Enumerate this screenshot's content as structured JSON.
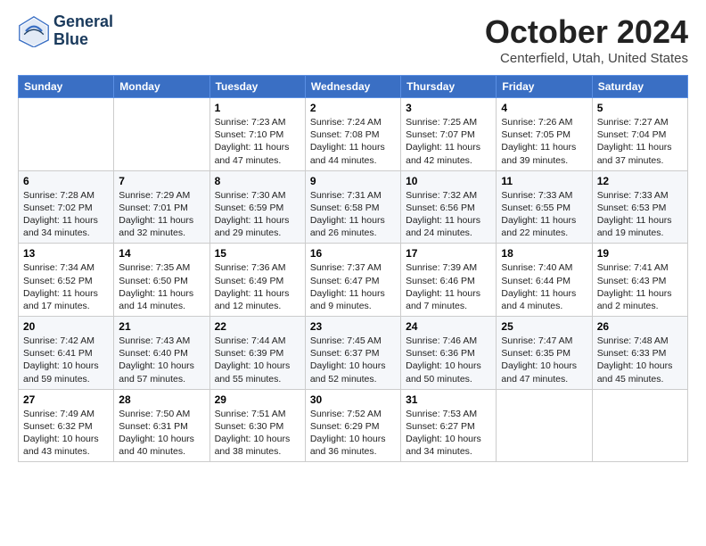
{
  "logo": {
    "line1": "General",
    "line2": "Blue"
  },
  "title": "October 2024",
  "subtitle": "Centerfield, Utah, United States",
  "days_of_week": [
    "Sunday",
    "Monday",
    "Tuesday",
    "Wednesday",
    "Thursday",
    "Friday",
    "Saturday"
  ],
  "weeks": [
    [
      {
        "day": "",
        "info": ""
      },
      {
        "day": "",
        "info": ""
      },
      {
        "day": "1",
        "info": "Sunrise: 7:23 AM\nSunset: 7:10 PM\nDaylight: 11 hours and 47 minutes."
      },
      {
        "day": "2",
        "info": "Sunrise: 7:24 AM\nSunset: 7:08 PM\nDaylight: 11 hours and 44 minutes."
      },
      {
        "day": "3",
        "info": "Sunrise: 7:25 AM\nSunset: 7:07 PM\nDaylight: 11 hours and 42 minutes."
      },
      {
        "day": "4",
        "info": "Sunrise: 7:26 AM\nSunset: 7:05 PM\nDaylight: 11 hours and 39 minutes."
      },
      {
        "day": "5",
        "info": "Sunrise: 7:27 AM\nSunset: 7:04 PM\nDaylight: 11 hours and 37 minutes."
      }
    ],
    [
      {
        "day": "6",
        "info": "Sunrise: 7:28 AM\nSunset: 7:02 PM\nDaylight: 11 hours and 34 minutes."
      },
      {
        "day": "7",
        "info": "Sunrise: 7:29 AM\nSunset: 7:01 PM\nDaylight: 11 hours and 32 minutes."
      },
      {
        "day": "8",
        "info": "Sunrise: 7:30 AM\nSunset: 6:59 PM\nDaylight: 11 hours and 29 minutes."
      },
      {
        "day": "9",
        "info": "Sunrise: 7:31 AM\nSunset: 6:58 PM\nDaylight: 11 hours and 26 minutes."
      },
      {
        "day": "10",
        "info": "Sunrise: 7:32 AM\nSunset: 6:56 PM\nDaylight: 11 hours and 24 minutes."
      },
      {
        "day": "11",
        "info": "Sunrise: 7:33 AM\nSunset: 6:55 PM\nDaylight: 11 hours and 22 minutes."
      },
      {
        "day": "12",
        "info": "Sunrise: 7:33 AM\nSunset: 6:53 PM\nDaylight: 11 hours and 19 minutes."
      }
    ],
    [
      {
        "day": "13",
        "info": "Sunrise: 7:34 AM\nSunset: 6:52 PM\nDaylight: 11 hours and 17 minutes."
      },
      {
        "day": "14",
        "info": "Sunrise: 7:35 AM\nSunset: 6:50 PM\nDaylight: 11 hours and 14 minutes."
      },
      {
        "day": "15",
        "info": "Sunrise: 7:36 AM\nSunset: 6:49 PM\nDaylight: 11 hours and 12 minutes."
      },
      {
        "day": "16",
        "info": "Sunrise: 7:37 AM\nSunset: 6:47 PM\nDaylight: 11 hours and 9 minutes."
      },
      {
        "day": "17",
        "info": "Sunrise: 7:39 AM\nSunset: 6:46 PM\nDaylight: 11 hours and 7 minutes."
      },
      {
        "day": "18",
        "info": "Sunrise: 7:40 AM\nSunset: 6:44 PM\nDaylight: 11 hours and 4 minutes."
      },
      {
        "day": "19",
        "info": "Sunrise: 7:41 AM\nSunset: 6:43 PM\nDaylight: 11 hours and 2 minutes."
      }
    ],
    [
      {
        "day": "20",
        "info": "Sunrise: 7:42 AM\nSunset: 6:41 PM\nDaylight: 10 hours and 59 minutes."
      },
      {
        "day": "21",
        "info": "Sunrise: 7:43 AM\nSunset: 6:40 PM\nDaylight: 10 hours and 57 minutes."
      },
      {
        "day": "22",
        "info": "Sunrise: 7:44 AM\nSunset: 6:39 PM\nDaylight: 10 hours and 55 minutes."
      },
      {
        "day": "23",
        "info": "Sunrise: 7:45 AM\nSunset: 6:37 PM\nDaylight: 10 hours and 52 minutes."
      },
      {
        "day": "24",
        "info": "Sunrise: 7:46 AM\nSunset: 6:36 PM\nDaylight: 10 hours and 50 minutes."
      },
      {
        "day": "25",
        "info": "Sunrise: 7:47 AM\nSunset: 6:35 PM\nDaylight: 10 hours and 47 minutes."
      },
      {
        "day": "26",
        "info": "Sunrise: 7:48 AM\nSunset: 6:33 PM\nDaylight: 10 hours and 45 minutes."
      }
    ],
    [
      {
        "day": "27",
        "info": "Sunrise: 7:49 AM\nSunset: 6:32 PM\nDaylight: 10 hours and 43 minutes."
      },
      {
        "day": "28",
        "info": "Sunrise: 7:50 AM\nSunset: 6:31 PM\nDaylight: 10 hours and 40 minutes."
      },
      {
        "day": "29",
        "info": "Sunrise: 7:51 AM\nSunset: 6:30 PM\nDaylight: 10 hours and 38 minutes."
      },
      {
        "day": "30",
        "info": "Sunrise: 7:52 AM\nSunset: 6:29 PM\nDaylight: 10 hours and 36 minutes."
      },
      {
        "day": "31",
        "info": "Sunrise: 7:53 AM\nSunset: 6:27 PM\nDaylight: 10 hours and 34 minutes."
      },
      {
        "day": "",
        "info": ""
      },
      {
        "day": "",
        "info": ""
      }
    ]
  ]
}
